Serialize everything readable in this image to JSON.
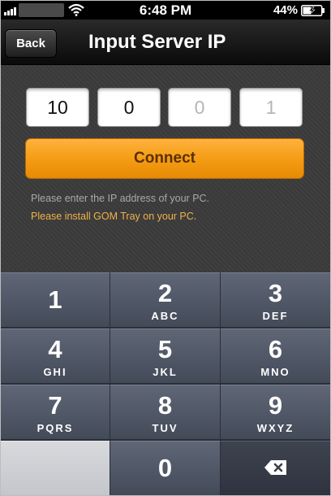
{
  "status_bar": {
    "time": "6:48 PM",
    "battery_percent": "44%",
    "battery_level": 0.44
  },
  "nav": {
    "back_label": "Back",
    "title": "Input Server IP"
  },
  "ip_fields": [
    {
      "text": "10",
      "state": "value"
    },
    {
      "text": "0",
      "state": "value"
    },
    {
      "text": "0",
      "state": "placeholder"
    },
    {
      "text": "1",
      "state": "placeholder"
    }
  ],
  "connect_label": "Connect",
  "hints": [
    "Please enter the IP address of your PC.",
    "Please install GOM Tray on your PC."
  ],
  "keypad": [
    {
      "digit": "1",
      "letters": ""
    },
    {
      "digit": "2",
      "letters": "ABC"
    },
    {
      "digit": "3",
      "letters": "DEF"
    },
    {
      "digit": "4",
      "letters": "GHI"
    },
    {
      "digit": "5",
      "letters": "JKL"
    },
    {
      "digit": "6",
      "letters": "MNO"
    },
    {
      "digit": "7",
      "letters": "PQRS"
    },
    {
      "digit": "8",
      "letters": "TUV"
    },
    {
      "digit": "9",
      "letters": "WXYZ"
    },
    {
      "digit": "",
      "letters": ""
    },
    {
      "digit": "0",
      "letters": ""
    },
    {
      "digit": "",
      "letters": ""
    }
  ],
  "colors": {
    "accent_orange": "#f39b12",
    "hint_highlight": "#f0b24a",
    "hint_text": "#a9a9a9"
  },
  "icons": [
    "signal-icon",
    "wifi-icon",
    "battery-icon",
    "delete-icon"
  ]
}
